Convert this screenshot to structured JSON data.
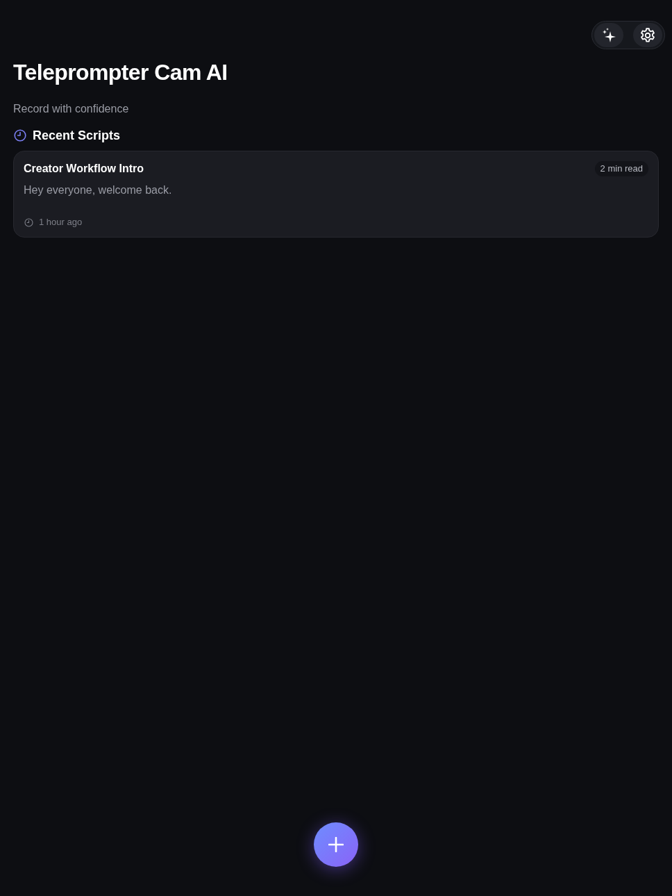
{
  "app": {
    "title": "Teleprompter Cam AI",
    "subtitle": "Record with confidence"
  },
  "recent": {
    "heading": "Recent Scripts",
    "scripts": [
      {
        "title": "Creator Workflow Intro",
        "read_time": "2 min read",
        "preview": "Hey everyone, welcome back.",
        "updated": "1 hour ago"
      }
    ]
  }
}
